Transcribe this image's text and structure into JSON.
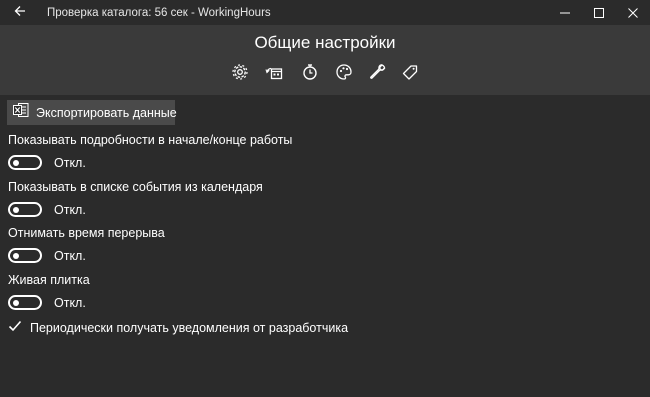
{
  "window": {
    "title": "Проверка каталога: 56 сек - WorkingHours",
    "controls": [
      "minimize-icon",
      "maximize-icon",
      "close-icon"
    ]
  },
  "header": {
    "title": "Общие настройки",
    "nav_icons": [
      "gear-icon",
      "calendar-sync-icon",
      "stopwatch-icon",
      "palette-icon",
      "wrench-icon",
      "tag-icon"
    ]
  },
  "export": {
    "label": "Экспортировать данные",
    "icon": "excel-icon"
  },
  "settings": [
    {
      "label": "Показывать подробности в начале/конце работы",
      "state": "Откл.",
      "on": false
    },
    {
      "label": "Показывать в списке события из календаря",
      "state": "Откл.",
      "on": false
    },
    {
      "label": "Отнимать время перерыва",
      "state": "Откл.",
      "on": false
    },
    {
      "label": "Живая плитка",
      "state": "Откл.",
      "on": false
    }
  ],
  "notifications": {
    "label": "Периодически получать уведомления от разработчика",
    "checked": true
  }
}
